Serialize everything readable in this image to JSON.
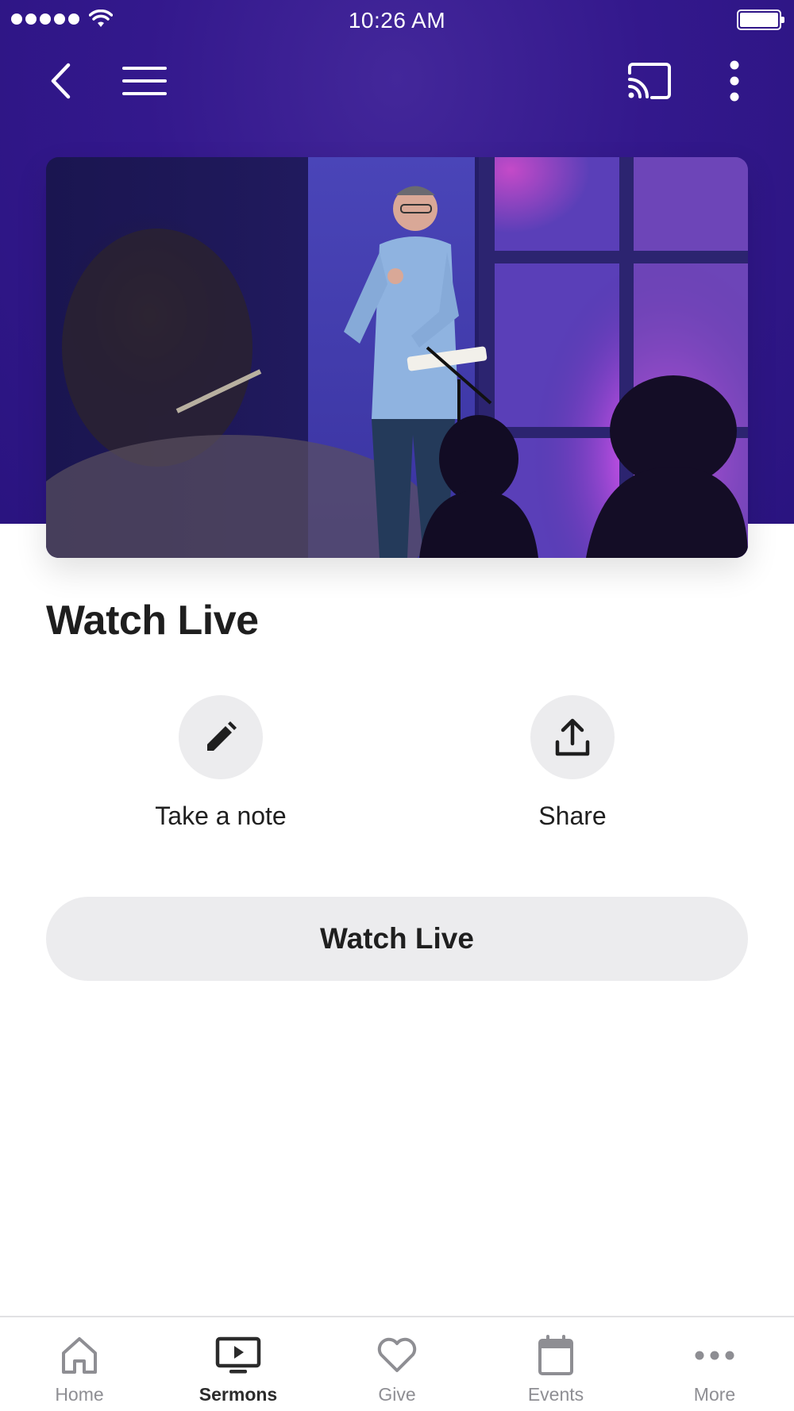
{
  "status_bar": {
    "time": "10:26 AM",
    "signal_icon": "signal-dots-icon",
    "wifi_icon": "wifi-icon",
    "battery_icon": "battery-full-icon"
  },
  "nav": {
    "back_icon": "chevron-left-icon",
    "menu_icon": "hamburger-menu-icon",
    "cast_icon": "cast-icon",
    "more_icon": "vertical-dots-icon"
  },
  "theme": {
    "header_color": "#33188c",
    "button_bg": "#ececee",
    "active_tab_color": "#2b2b2b",
    "inactive_tab_color": "#8e8e93"
  },
  "hero": {
    "image_subject": "preacher on stage holding a bible"
  },
  "page": {
    "title": "Watch Live"
  },
  "actions": [
    {
      "label": "Take a note",
      "icon": "pencil-icon"
    },
    {
      "label": "Share",
      "icon": "share-upload-icon"
    }
  ],
  "watch_button": {
    "label": "Watch Live"
  },
  "tabs": [
    {
      "label": "Home",
      "icon": "home-icon",
      "active": false
    },
    {
      "label": "Sermons",
      "icon": "video-play-icon",
      "active": true
    },
    {
      "label": "Give",
      "icon": "heart-icon",
      "active": false
    },
    {
      "label": "Events",
      "icon": "calendar-icon",
      "active": false
    },
    {
      "label": "More",
      "icon": "more-dots-icon",
      "active": false
    }
  ]
}
